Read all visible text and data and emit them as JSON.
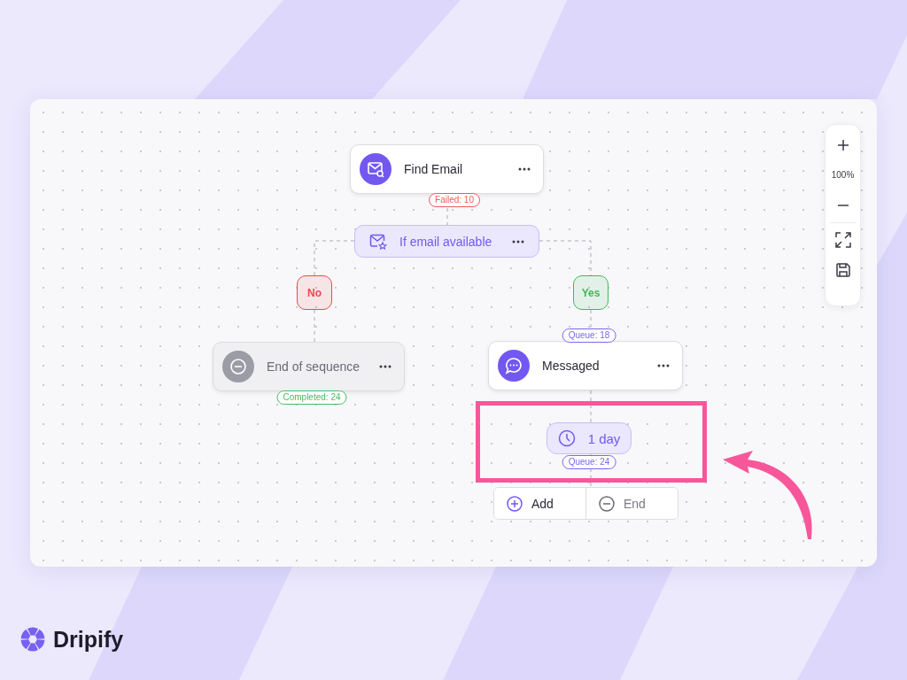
{
  "canvas": {
    "nodes": [
      {
        "kind": "action",
        "label": "Find Email"
      },
      {
        "kind": "condition",
        "label": "If email available"
      },
      {
        "kind": "end",
        "label": "End of sequence"
      },
      {
        "kind": "action",
        "label": "Messaged"
      },
      {
        "kind": "delay",
        "label": "1 day"
      }
    ],
    "branches": [
      {
        "label": "No",
        "color": "#f04848"
      },
      {
        "label": "Yes",
        "color": "#3fb85a"
      }
    ],
    "badges": [
      {
        "text": "Failed: 10",
        "color": "#f05a5a"
      },
      {
        "text": "Queue: 18",
        "color": "#7a68f0"
      },
      {
        "text": "Completed: 24",
        "color": "#46bd62"
      },
      {
        "text": "Queue: 24",
        "color": "#7a68f0"
      }
    ],
    "actions": [
      "Add",
      "End"
    ]
  },
  "zoom": {
    "level_text": "100%"
  },
  "brand": "Dripify"
}
